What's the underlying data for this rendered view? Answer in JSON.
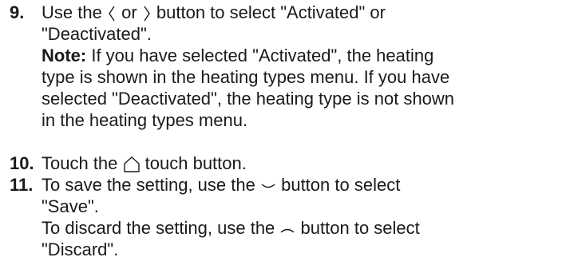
{
  "steps": [
    {
      "number": "9.",
      "lines": {
        "l1_pre": "Use the",
        "l1_or": "or",
        "l1_post": "button to select \"Activated\" or",
        "l2": "\"Deactivated\".",
        "note_label": "Note:",
        "note_l1": "If you have selected \"Activated\", the heating",
        "note_l2": "type is shown in the heating types menu. If you have",
        "note_l3": "selected \"Deactivated\", the heating type is not shown",
        "note_l4": "in the heating types menu."
      },
      "icons": [
        "angle-left-icon",
        "angle-right-icon"
      ]
    },
    {
      "number": "10.",
      "lines": {
        "l1_pre": "Touch the",
        "l1_post": "touch button."
      },
      "icons": [
        "home-icon"
      ]
    },
    {
      "number": "11.",
      "lines": {
        "l1_pre": "To save the setting, use the",
        "l1_post": "button to select",
        "l2": "\"Save\".",
        "l3_pre": "To discard the setting, use the",
        "l3_post": "button to select",
        "l4": "\"Discard\"."
      },
      "icons": [
        "chevron-down-icon",
        "chevron-up-icon"
      ]
    }
  ]
}
